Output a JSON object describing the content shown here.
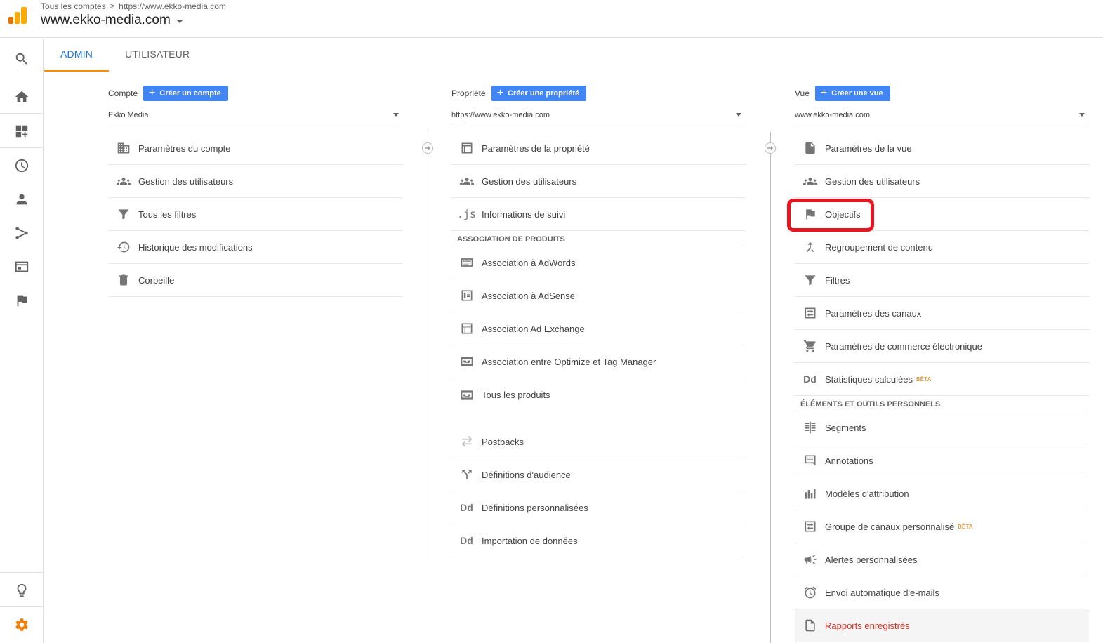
{
  "header": {
    "breadcrumb": [
      "Tous les comptes",
      "https://www.ekko-media.com"
    ],
    "account_title": "www.ekko-media.com"
  },
  "tabs": [
    {
      "label": "ADMIN",
      "active": true
    },
    {
      "label": "UTILISATEUR",
      "active": false
    }
  ],
  "account_col": {
    "label": "Compte",
    "create_label": "Créer un compte",
    "selected": "Ekko Media",
    "items": [
      {
        "icon": "building-icon",
        "label": "Paramètres du compte"
      },
      {
        "icon": "people-icon",
        "label": "Gestion des utilisateurs"
      },
      {
        "icon": "filter-icon",
        "label": "Tous les filtres"
      },
      {
        "icon": "history-icon",
        "label": "Historique des modifications"
      },
      {
        "icon": "trash-icon",
        "label": "Corbeille"
      }
    ]
  },
  "property_col": {
    "label": "Propriété",
    "create_label": "Créer une propriété",
    "selected": "https://www.ekko-media.com",
    "items": [
      {
        "icon": "window-icon",
        "label": "Paramètres de la propriété"
      },
      {
        "icon": "people-icon",
        "label": "Gestion des utilisateurs"
      },
      {
        "icon": "js-icon",
        "label": "Informations de suivi",
        "glyph": ".js"
      }
    ],
    "section_label": "ASSOCIATION DE PRODUITS",
    "products": [
      {
        "icon": "adwords-icon",
        "label": "Association à AdWords"
      },
      {
        "icon": "adsense-icon",
        "label": "Association à AdSense"
      },
      {
        "icon": "adexchange-icon",
        "label": "Association Ad Exchange"
      },
      {
        "icon": "link-icon",
        "label": "Association entre Optimize et Tag Manager"
      },
      {
        "icon": "link-icon",
        "label": "Tous les produits"
      }
    ],
    "more": [
      {
        "icon": "postbacks-icon",
        "label": "Postbacks"
      },
      {
        "icon": "fork-icon",
        "label": "Définitions d'audience"
      },
      {
        "icon": "dd-icon",
        "label": "Définitions personnalisées",
        "glyph": "Dd"
      },
      {
        "icon": "dd-icon",
        "label": "Importation de données",
        "glyph": "Dd"
      }
    ]
  },
  "view_col": {
    "label": "Vue",
    "create_label": "Créer une vue",
    "selected": "www.ekko-media.com",
    "items": [
      {
        "icon": "document-icon",
        "label": "Paramètres de la vue"
      },
      {
        "icon": "people-icon",
        "label": "Gestion des utilisateurs"
      },
      {
        "icon": "flag-icon",
        "label": "Objectifs"
      },
      {
        "icon": "merge-icon",
        "label": "Regroupement de contenu"
      },
      {
        "icon": "filter-icon",
        "label": "Filtres"
      },
      {
        "icon": "channels-icon",
        "label": "Paramètres des canaux"
      },
      {
        "icon": "cart-icon",
        "label": "Paramètres de commerce électronique"
      },
      {
        "icon": "dd-icon",
        "label": "Statistiques calculées",
        "glyph": "Dd",
        "badge": "BÊTA"
      }
    ],
    "section_label": "ÉLÉMENTS ET OUTILS PERSONNELS",
    "tools": [
      {
        "icon": "segments-icon",
        "label": "Segments"
      },
      {
        "icon": "comment-icon",
        "label": "Annotations"
      },
      {
        "icon": "bars-icon",
        "label": "Modèles d'attribution"
      },
      {
        "icon": "channels-icon",
        "label": "Groupe de canaux personnalisé",
        "badge": "BÊTA"
      },
      {
        "icon": "megaphone-icon",
        "label": "Alertes personnalisées"
      },
      {
        "icon": "alarm-icon",
        "label": "Envoi automatique d'e-mails"
      },
      {
        "icon": "saved-report-icon",
        "label": "Rapports enregistrés"
      }
    ]
  },
  "colors": {
    "accent": "#1a73e8",
    "button": "#4285f4",
    "tab_underline": "#fb8c00",
    "gear": "#f57c00",
    "beta": "#e67c00",
    "annotation": "#e8141f"
  }
}
